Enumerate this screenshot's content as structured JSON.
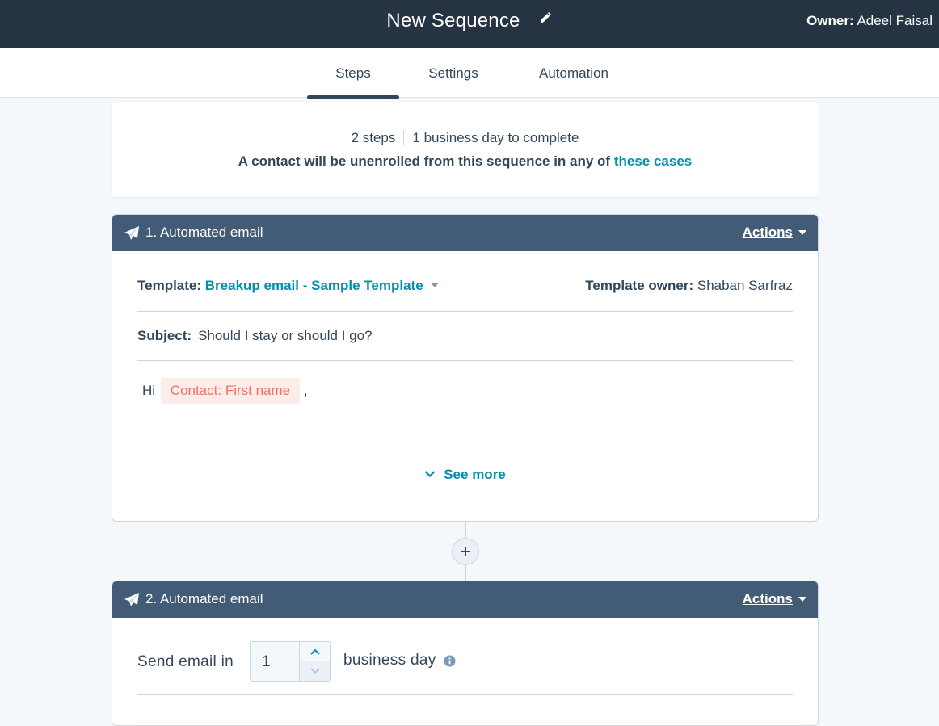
{
  "header": {
    "title": "New Sequence",
    "edit_icon": "pencil-icon",
    "owner_label": "Owner:",
    "owner_name": "Adeel Faisal"
  },
  "tabs": [
    {
      "label": "Steps",
      "active": true
    },
    {
      "label": "Settings",
      "active": false
    },
    {
      "label": "Automation",
      "active": false
    }
  ],
  "summary": {
    "steps": "2 steps",
    "duration": "1 business day to complete",
    "unenroll_text": "A contact will be unenrolled from this sequence in any of",
    "unenroll_link": "these cases"
  },
  "steps": [
    {
      "title": "1. Automated email",
      "icon": "paper-plane-icon",
      "actions_label": "Actions",
      "template_label": "Template:",
      "template_name": "Breakup email - Sample Template",
      "template_owner_label": "Template owner:",
      "template_owner": "Shaban Sarfraz",
      "subject_label": "Subject:",
      "subject": "Should I stay or should I go?",
      "body_greeting": "Hi",
      "body_token": "Contact: First name",
      "body_after": ",",
      "see_more": "See more"
    },
    {
      "title": "2. Automated email",
      "icon": "paper-plane-icon",
      "actions_label": "Actions",
      "send_label": "Send email in",
      "delay_value": "1",
      "delay_unit": "business day"
    }
  ],
  "colors": {
    "topbar": "#253342",
    "card_header": "#425b76",
    "link": "#0091ae",
    "token_bg": "#fdedea",
    "token_text": "#f2745f",
    "page_bg": "#f5f8fa"
  }
}
